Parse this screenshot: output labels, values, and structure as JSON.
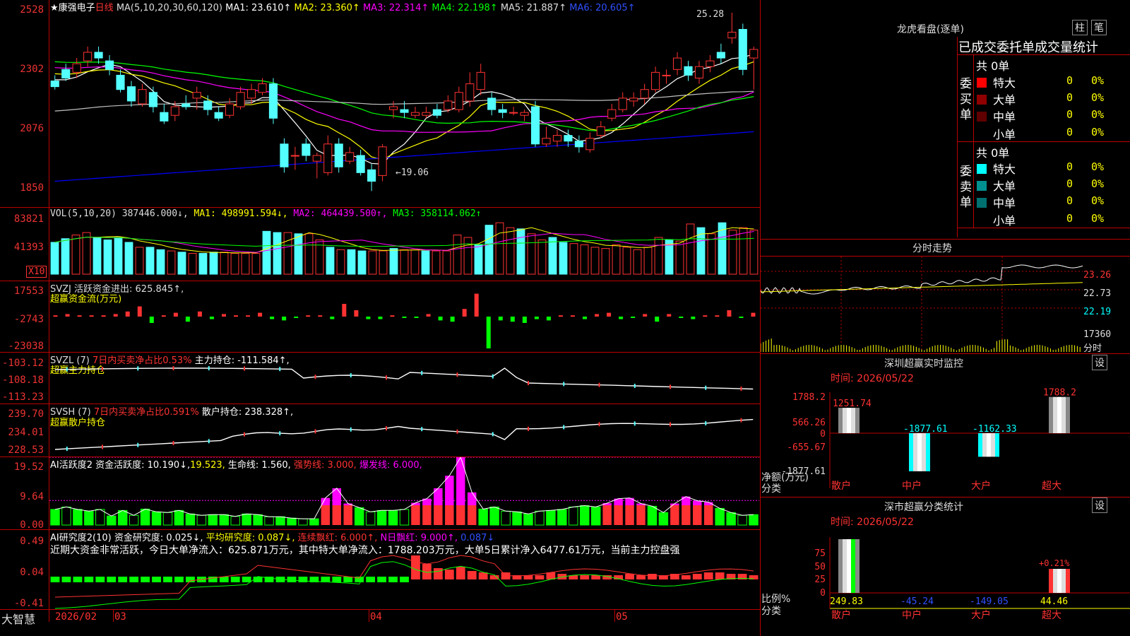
{
  "main": {
    "title": "★康强电子",
    "period": "日线",
    "ma_header": "MA(5,10,20,30,60,120)",
    "ma1": "MA1: 23.610↑",
    "ma2": "MA2: 23.360↑",
    "ma3": "MA3: 22.314↑",
    "ma4": "MA4: 22.198↑",
    "ma5": "MA5: 21.887↑",
    "ma6": "MA6: 20.605↑",
    "high_mark": "25.28",
    "low_mark": "←19.06",
    "y_ticks": [
      "2528",
      "2302",
      "2076",
      "1850"
    ]
  },
  "vol": {
    "header": "VOL(5,10,20)",
    "value": "387446.000↓,",
    "ma1": "MA1: 498991.594↓,",
    "ma2": "MA2: 464439.500↑,",
    "ma3": "MA3: 358114.062↑",
    "y_ticks": [
      "83821",
      "41393"
    ],
    "x10": "X10"
  },
  "svzj": {
    "header": "SVZJ  活跃资金进出: 625.845↑,",
    "sub": "超赢资金流(万元)",
    "y_ticks": [
      "17553",
      "-2743",
      "-23038"
    ]
  },
  "svzl": {
    "header_a": "SVZL (7)",
    "header_b": "7日内买卖净占比0.53%",
    "header_c": "主力持仓: -111.584↑,",
    "sub": "超赢主力持仓",
    "y_ticks": [
      "-103.12",
      "-108.18",
      "-113.23"
    ]
  },
  "svsh": {
    "header_a": "SVSH (7)",
    "header_b": "7日内买卖净占比0.591%",
    "header_c": "散户持仓: 238.328↑,",
    "sub": "超赢散户持仓",
    "y_ticks": [
      "239.70",
      "234.01",
      "228.53"
    ]
  },
  "ai1": {
    "header_a": "AI活跃度2 资金活跃度: 10.190↓,",
    "header_b": "19.523,",
    "header_c": "生命线: 1.560,",
    "header_d": "强势线: 3.000,",
    "header_e": "爆发线: 6.000,",
    "y_ticks": [
      "19.52",
      "9.64",
      "0.00"
    ]
  },
  "ai2": {
    "header_a": "AI研究度2(10) 资金研究度: 0.025↓,",
    "header_b": "平均研究度: 0.087↓,",
    "header_c": "连续飘红: 6.000↑,",
    "header_d": "N日飘红: 9.000↑,",
    "header_e": "0.087↓",
    "summary": "近期大资金非常活跃，今日大单净流入：625.871万元，其中特大单净流入：1788.203万元，大单5日累计净入6477.61万元，当前主力控盘强",
    "y_ticks": [
      "0.49",
      "0.04",
      "-0.41"
    ]
  },
  "xaxis": {
    "brand": "大智慧",
    "labels": [
      "2026/02",
      "03",
      "04",
      "05"
    ]
  },
  "right": {
    "lhb_title": "龙虎看盘(逐单)",
    "btn_zhu": "柱",
    "btn_bi": "笔",
    "stat_title": "已成交委托单成交量统计",
    "buy": {
      "side_label": "委买单",
      "total": "共 0单",
      "rows": [
        {
          "name": "特大",
          "vol": "0",
          "pct": "0%"
        },
        {
          "name": "大单",
          "vol": "0",
          "pct": "0%"
        },
        {
          "name": "中单",
          "vol": "0",
          "pct": "0%"
        },
        {
          "name": "小单",
          "vol": "0",
          "pct": "0%"
        }
      ]
    },
    "sell": {
      "side_label": "委卖单",
      "total": "共 0单",
      "rows": [
        {
          "name": "特大",
          "vol": "0",
          "pct": "0%"
        },
        {
          "name": "大单",
          "vol": "0",
          "pct": "0%"
        },
        {
          "name": "中单",
          "vol": "0",
          "pct": "0%"
        },
        {
          "name": "小单",
          "vol": "0",
          "pct": "0%"
        }
      ]
    },
    "fenshi": {
      "title": "分时走势",
      "y_ticks": [
        "23.26",
        "22.73",
        "22.19"
      ],
      "vol_tick": "17360",
      "vol_label": "分时"
    },
    "monitor": {
      "title": "深圳超赢实时监控",
      "set": "设",
      "time": "时间: 2026/05/22",
      "y_ticks": [
        "1788.2",
        "566.26",
        "0",
        "-655.67",
        "-1877.61"
      ],
      "y_label1": "净额(万元)",
      "y_label2": "分类",
      "bars": [
        {
          "cat": "散户",
          "value": 1251.74,
          "label": "1251.74"
        },
        {
          "cat": "中户",
          "value": -1877.61,
          "label": "-1877.61"
        },
        {
          "cat": "大户",
          "value": -1162.33,
          "label": "-1162.33"
        },
        {
          "cat": "超大",
          "value": 1788.2,
          "label": "1788.2"
        }
      ]
    },
    "classify": {
      "title": "深市超赢分类统计",
      "set": "设",
      "time": "时间: 2026/05/22",
      "y_ticks": [
        "75",
        "50",
        "25",
        "0"
      ],
      "y_label1": "比例%",
      "y_label2": "分类",
      "bars": [
        {
          "cat": "散户",
          "value": 249.83,
          "label": "249.83"
        },
        {
          "cat": "中户",
          "value": -45.24,
          "label": "-45.24"
        },
        {
          "cat": "大户",
          "value": -149.05,
          "label": "-149.05"
        },
        {
          "cat": "超大",
          "value": 44.46,
          "label": "44.46",
          "top": "+0.21%"
        }
      ]
    }
  },
  "colors": {
    "up": "#ff3232",
    "down": "#54ffff",
    "green": "#00ff00",
    "magenta": "#ff00ff",
    "yellow": "#ffff00",
    "white": "#ffffff",
    "gridred": "#b00000"
  },
  "chart_data": {
    "type": "candlestick",
    "y_range": [
      18.5,
      25.28
    ],
    "candles_ohlc": [
      [
        22.9,
        22.7,
        23.1,
        22.6
      ],
      [
        23.3,
        23.0,
        23.5,
        22.9
      ],
      [
        23.2,
        23.5,
        23.7,
        23.0
      ],
      [
        23.6,
        23.9,
        24.1,
        23.4
      ],
      [
        23.9,
        23.7,
        24.1,
        23.5
      ],
      [
        23.6,
        23.3,
        23.8,
        23.1
      ],
      [
        23.1,
        22.6,
        23.3,
        22.5
      ],
      [
        22.7,
        22.2,
        22.9,
        22.0
      ],
      [
        22.1,
        22.6,
        22.8,
        22.0
      ],
      [
        22.5,
        22.0,
        22.7,
        21.8
      ],
      [
        21.8,
        21.5,
        22.1,
        21.4
      ],
      [
        21.7,
        22.0,
        22.2,
        21.5
      ],
      [
        22.1,
        22.0,
        22.4,
        21.9
      ],
      [
        22.3,
        22.5,
        22.7,
        21.9
      ],
      [
        22.2,
        21.9,
        22.4,
        21.7
      ],
      [
        21.8,
        21.6,
        22.0,
        21.5
      ],
      [
        21.7,
        22.1,
        22.3,
        21.6
      ],
      [
        22.0,
        22.5,
        22.7,
        21.9
      ],
      [
        22.3,
        22.6,
        22.8,
        22.1
      ],
      [
        22.5,
        22.8,
        23.0,
        22.4
      ],
      [
        22.8,
        21.6,
        23.0,
        21.4
      ],
      [
        20.7,
        19.9,
        20.9,
        19.7
      ],
      [
        20.3,
        20.3,
        20.6,
        19.8
      ],
      [
        20.7,
        20.3,
        20.9,
        20.1
      ],
      [
        20.1,
        20.3,
        20.4,
        19.5
      ],
      [
        19.7,
        20.7,
        21.0,
        19.6
      ],
      [
        20.7,
        19.9,
        20.9,
        19.7
      ],
      [
        20.1,
        20.4,
        20.6,
        20.0
      ],
      [
        20.3,
        19.7,
        20.5,
        19.6
      ],
      [
        19.8,
        19.4,
        20.0,
        19.06
      ],
      [
        19.6,
        20.6,
        20.7,
        19.4
      ],
      [
        21.9,
        22.0,
        22.2,
        21.6
      ],
      [
        21.9,
        21.8,
        22.2,
        21.6
      ],
      [
        21.7,
        21.8,
        22.0,
        21.6
      ],
      [
        21.7,
        21.8,
        22.0,
        21.6
      ],
      [
        21.9,
        21.7,
        22.1,
        21.6
      ],
      [
        21.9,
        22.2,
        22.4,
        21.8
      ],
      [
        21.9,
        22.5,
        22.7,
        21.8
      ],
      [
        22.2,
        22.8,
        23.2,
        22.0
      ],
      [
        22.6,
        23.2,
        23.5,
        22.4
      ],
      [
        22.3,
        21.9,
        22.5,
        21.7
      ],
      [
        21.9,
        21.8,
        22.1,
        21.6
      ],
      [
        21.8,
        21.8,
        22.0,
        21.7
      ],
      [
        21.7,
        21.8,
        21.9,
        21.5
      ],
      [
        22.0,
        20.7,
        22.2,
        20.6
      ],
      [
        20.7,
        20.9,
        21.3,
        20.6
      ],
      [
        20.8,
        21.0,
        21.2,
        20.6
      ],
      [
        21.0,
        20.8,
        21.2,
        20.6
      ],
      [
        20.8,
        20.6,
        21.0,
        20.4
      ],
      [
        20.5,
        20.9,
        21.1,
        20.4
      ],
      [
        21.0,
        21.3,
        21.5,
        20.9
      ],
      [
        21.6,
        21.9,
        22.1,
        21.5
      ],
      [
        21.9,
        22.3,
        22.5,
        21.8
      ],
      [
        22.2,
        22.3,
        22.5,
        22.0
      ],
      [
        22.3,
        22.6,
        22.8,
        22.1
      ],
      [
        22.6,
        23.2,
        23.4,
        22.5
      ],
      [
        23.1,
        23.1,
        23.3,
        22.8
      ],
      [
        23.3,
        23.7,
        23.9,
        23.1
      ],
      [
        23.4,
        23.1,
        23.6,
        22.9
      ],
      [
        23.0,
        23.4,
        23.6,
        22.8
      ],
      [
        23.4,
        23.6,
        23.8,
        23.2
      ],
      [
        23.9,
        23.7,
        24.2,
        23.5
      ],
      [
        24.4,
        24.6,
        25.28,
        24.2
      ],
      [
        24.7,
        23.3,
        24.9,
        23.1
      ],
      [
        23.7,
        24.0,
        24.1,
        22.6
      ]
    ],
    "ma_series": [
      {
        "name": "MA1",
        "color": "#ffffff"
      },
      {
        "name": "MA2",
        "color": "#ffff00"
      },
      {
        "name": "MA3",
        "color": "#ff00ff"
      },
      {
        "name": "MA4",
        "color": "#00ff00"
      },
      {
        "name": "MA5",
        "color": "#c0c0c0"
      },
      {
        "name": "MA6",
        "color": "#0000ff"
      }
    ],
    "vol_values": [
      26,
      29,
      32,
      34,
      30,
      28,
      30,
      26,
      22,
      22,
      20,
      19,
      18,
      17,
      17,
      18,
      18,
      17,
      17,
      17,
      35,
      34,
      34,
      33,
      33,
      28,
      22,
      20,
      20,
      19,
      19,
      19,
      21,
      20,
      20,
      19,
      19,
      19,
      32,
      30,
      24,
      40,
      42,
      38,
      37,
      33,
      28,
      30,
      26,
      25,
      24,
      22,
      21,
      24,
      22,
      20,
      22,
      30,
      28,
      27,
      41,
      38,
      33,
      42,
      36,
      38,
      36
    ],
    "svzj_values": [
      1,
      2,
      1,
      1,
      1,
      2,
      4,
      8,
      -5,
      1,
      3,
      -4,
      4,
      -2,
      2,
      1,
      1,
      3,
      -2,
      -3,
      -1,
      1,
      1,
      -2,
      10,
      5,
      -2,
      -2,
      1,
      -1,
      -1,
      2,
      -3,
      -4,
      6,
      18,
      -25,
      -3,
      -4,
      -5,
      -2,
      -3,
      1,
      1,
      -2,
      2,
      3,
      -2,
      -1,
      2,
      -4,
      2,
      -1,
      -2,
      1,
      1,
      5,
      -1,
      3
    ],
    "ai1_values": [
      4.5,
      5.2,
      4.5,
      4.0,
      4.5,
      2.6,
      4.2,
      2.8,
      4.6,
      3.8,
      3.6,
      4.2,
      3.2,
      2.8,
      3.0,
      3.0,
      2.5,
      3.2,
      3.0,
      2.4,
      2.4,
      2.0,
      1.8,
      1.8,
      7.8,
      10.6,
      6.2,
      5.0,
      3.8,
      4.2,
      4.2,
      4.5,
      6.4,
      7.6,
      10.6,
      14.2,
      19.5,
      9.4,
      4.6,
      5.2,
      4.0,
      3.8,
      3.2,
      4.0,
      4.2,
      4.5,
      5.2,
      5.6,
      5.2,
      6.3,
      7.6,
      7.8,
      6.2,
      5.4,
      3.6,
      6.2,
      8.2,
      7.0,
      6.6,
      4.8,
      3.6,
      2.8,
      3.0
    ],
    "ai2_values": [
      0.03,
      0.05,
      0.05,
      0.06,
      0.02,
      0.02,
      0.04,
      0.04,
      0.04,
      0.02,
      0.03,
      0.02,
      0.03,
      0.02,
      0.02,
      0.02,
      0.03,
      0.03,
      0.02,
      0.02,
      0.01,
      0.01,
      0.01,
      0.01,
      0.02,
      0.04,
      0.04,
      0.04,
      0.02,
      0.02,
      0.02,
      0.02,
      0.17,
      0.11,
      0.08,
      0.07,
      0.09,
      0.06,
      0.05,
      0.03,
      0.05,
      0.03,
      0.03,
      0.03,
      0.05,
      0.04,
      0.03,
      0.03,
      0.03,
      0.03,
      0.03,
      0.04,
      0.03,
      0.04,
      0.03,
      0.04,
      0.03,
      0.04,
      0.05,
      0.05,
      0.04,
      0.04,
      0.03
    ]
  }
}
